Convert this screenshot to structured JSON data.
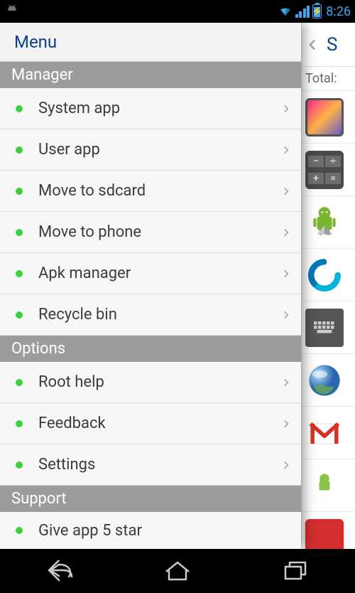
{
  "status": {
    "time": "8:26"
  },
  "drawer": {
    "title": "Menu",
    "sections": [
      {
        "header": "Manager",
        "items": [
          {
            "label": "System app"
          },
          {
            "label": "User app"
          },
          {
            "label": "Move to sdcard"
          },
          {
            "label": "Move to phone"
          },
          {
            "label": "Apk manager"
          },
          {
            "label": "Recycle bin"
          }
        ]
      },
      {
        "header": "Options",
        "items": [
          {
            "label": "Root help"
          },
          {
            "label": "Feedback"
          },
          {
            "label": "Settings"
          }
        ]
      },
      {
        "header": "Support",
        "items": [
          {
            "label": "Give app 5 star"
          }
        ]
      }
    ]
  },
  "underlay": {
    "title_letter": "S",
    "subtitle_prefix": "Total:"
  },
  "icons": {
    "chevron": "chevron-right-icon",
    "back": "chevron-left-icon",
    "android": "android-icon",
    "wifi": "wifi-icon",
    "signal": "signal-icon",
    "battery": "battery-charging-icon",
    "nav_back": "nav-back-icon",
    "nav_home": "nav-home-icon",
    "nav_recent": "nav-recent-icon"
  },
  "colors": {
    "accent_blue": "#0b3f8f",
    "status_blue": "#3aa6f2",
    "bullet_green": "#3bd13b",
    "section_gray": "#9c9c9c"
  }
}
